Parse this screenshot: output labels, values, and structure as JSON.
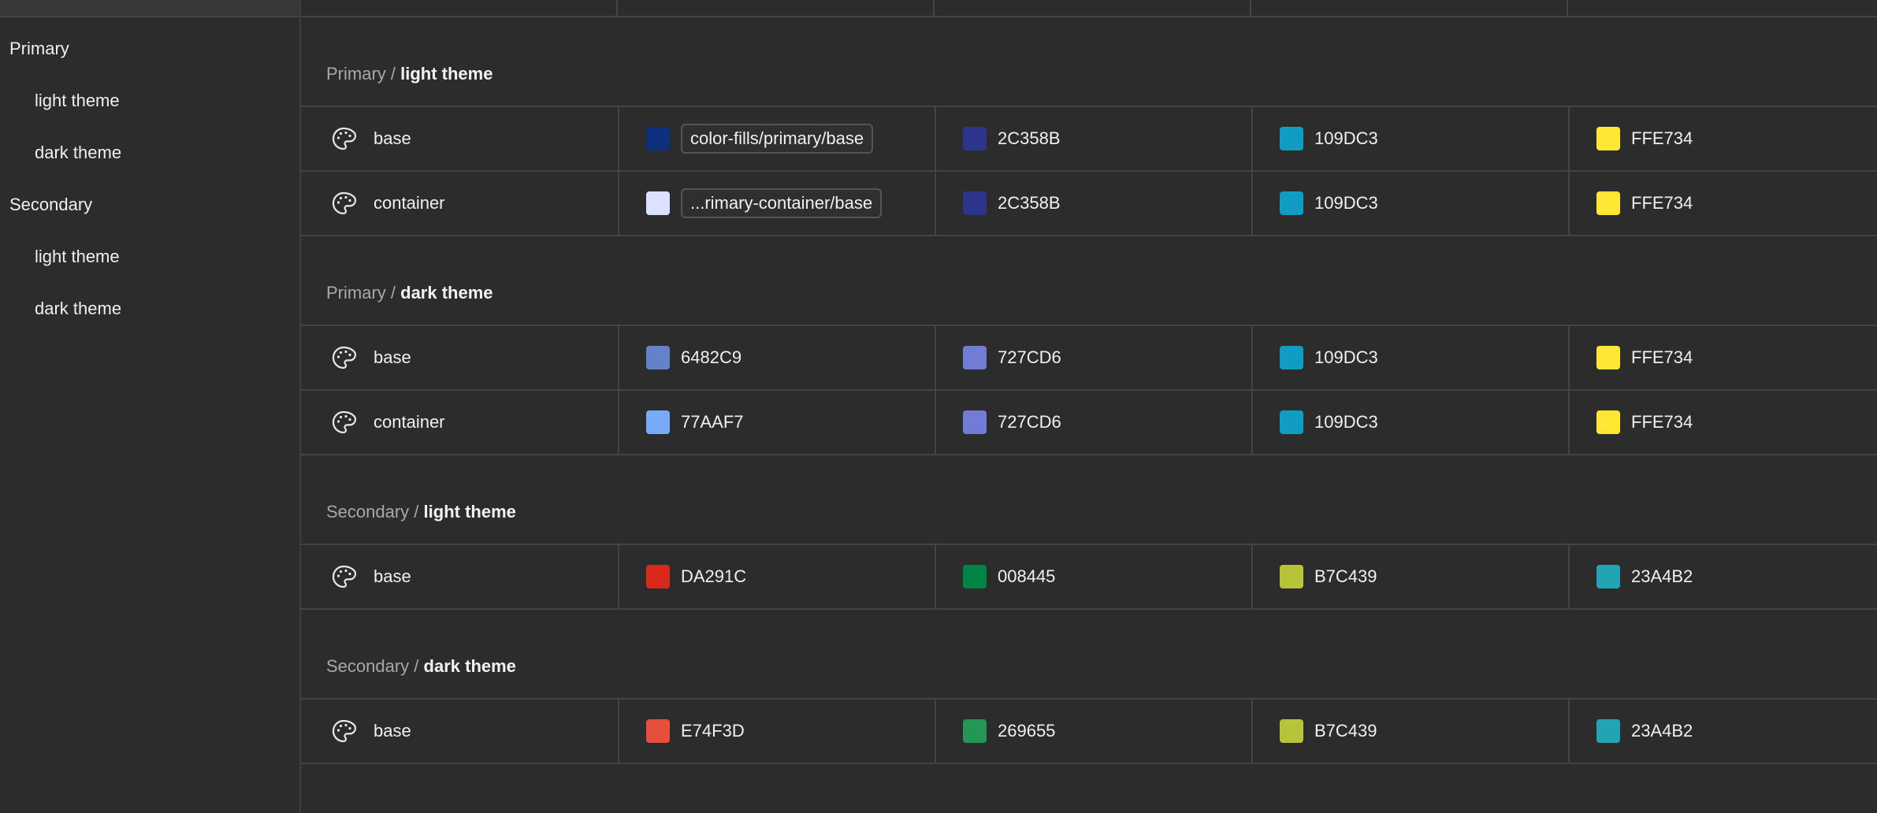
{
  "sidebar": {
    "groups": [
      {
        "label": "Primary",
        "items": [
          {
            "label": "light theme"
          },
          {
            "label": "dark theme"
          }
        ]
      },
      {
        "label": "Secondary",
        "items": [
          {
            "label": "light theme"
          },
          {
            "label": "dark theme"
          }
        ]
      }
    ]
  },
  "sections": [
    {
      "group": "Primary",
      "sep": " / ",
      "theme": "light theme",
      "rows": [
        {
          "name": "base",
          "icon": "palette-icon",
          "cells": [
            {
              "color": "#0E2F7C",
              "text": "color-fills/primary/base",
              "alias": true
            },
            {
              "color": "#2C358B",
              "text": "2C358B"
            },
            {
              "color": "#109DC3",
              "text": "109DC3"
            },
            {
              "color": "#FFE734",
              "text": "FFE734"
            }
          ]
        },
        {
          "name": "container",
          "icon": "palette-icon",
          "cells": [
            {
              "color": "#DAE2FF",
              "text": "...rimary-container/base",
              "alias": true
            },
            {
              "color": "#2C358B",
              "text": "2C358B"
            },
            {
              "color": "#109DC3",
              "text": "109DC3"
            },
            {
              "color": "#FFE734",
              "text": "FFE734"
            }
          ]
        }
      ]
    },
    {
      "group": "Primary",
      "sep": " / ",
      "theme": "dark theme",
      "rows": [
        {
          "name": "base",
          "icon": "palette-icon",
          "cells": [
            {
              "color": "#6482C9",
              "text": "6482C9"
            },
            {
              "color": "#727CD6",
              "text": "727CD6"
            },
            {
              "color": "#109DC3",
              "text": "109DC3"
            },
            {
              "color": "#FFE734",
              "text": "FFE734"
            }
          ]
        },
        {
          "name": "container",
          "icon": "palette-icon",
          "cells": [
            {
              "color": "#77AAF7",
              "text": "77AAF7"
            },
            {
              "color": "#727CD6",
              "text": "727CD6"
            },
            {
              "color": "#109DC3",
              "text": "109DC3"
            },
            {
              "color": "#FFE734",
              "text": "FFE734"
            }
          ]
        }
      ]
    },
    {
      "group": "Secondary",
      "sep": " / ",
      "theme": "light theme",
      "rows": [
        {
          "name": "base",
          "icon": "palette-icon",
          "cells": [
            {
              "color": "#DA291C",
              "text": "DA291C"
            },
            {
              "color": "#008445",
              "text": "008445"
            },
            {
              "color": "#B7C439",
              "text": "B7C439"
            },
            {
              "color": "#23A4B2",
              "text": "23A4B2"
            }
          ]
        }
      ]
    },
    {
      "group": "Secondary",
      "sep": " / ",
      "theme": "dark theme",
      "rows": [
        {
          "name": "base",
          "icon": "palette-icon",
          "cells": [
            {
              "color": "#E74F3D",
              "text": "E74F3D"
            },
            {
              "color": "#269655",
              "text": "269655"
            },
            {
              "color": "#B7C439",
              "text": "B7C439"
            },
            {
              "color": "#23A4B2",
              "text": "23A4B2"
            }
          ]
        }
      ]
    }
  ]
}
